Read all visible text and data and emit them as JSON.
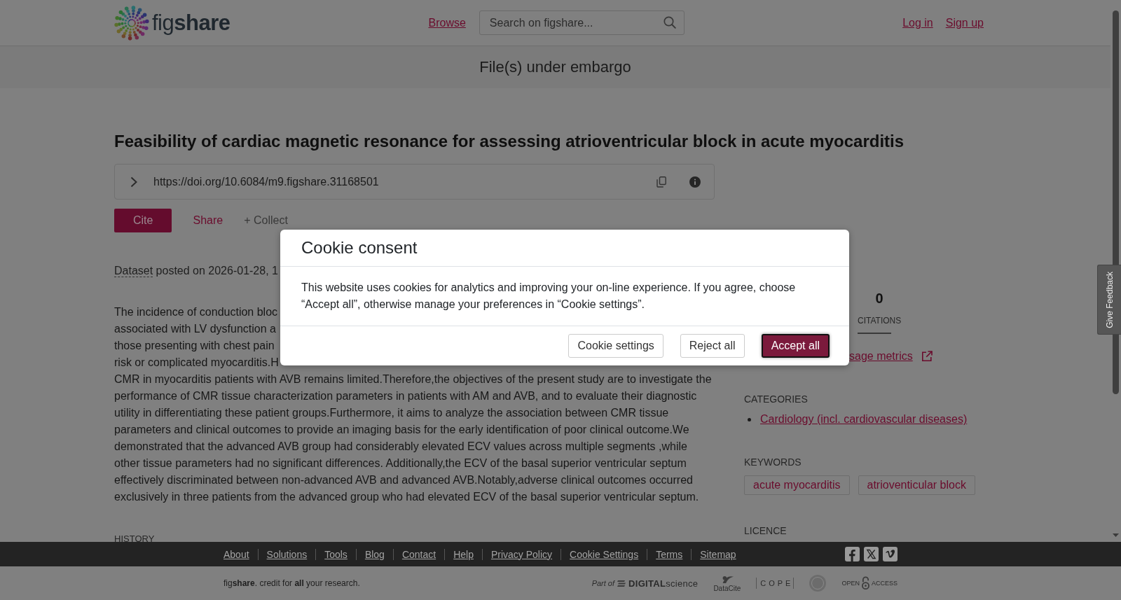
{
  "header": {
    "logo": "fig**share**",
    "nav": [
      "Browse"
    ],
    "search": {
      "placeholder": "Search on figshare..."
    },
    "account_links": [
      "Log in",
      "Sign up"
    ]
  },
  "notice": {
    "text": "File(s) under embargo"
  },
  "item": {
    "title": "Feasibility of cardiac magnetic resonance for assessing atrioventricular block in acute myocarditis",
    "doi": "https://doi.org/10.6084/m9.figshare.31168501",
    "actions": [
      {
        "label": "Cite",
        "kind": "primary"
      },
      {
        "label": "Share",
        "kind": "link"
      },
      {
        "label": "+ Collect",
        "kind": "plain"
      }
    ],
    "item_type": "Dataset",
    "posted": "posted on 2026-01-28, 1",
    "description_lines": [
      "The incidence of conduction bloc",
      "associated with LV dysfunction a",
      "those presenting with chest pain",
      "risk or complicated myocarditis.H",
      "CMR in myocarditis patients with AVB remains limited.Therefore,the objectives of the present study are to investigate the",
      "performance of CMR tissue characterization parameters in patients with AM and AVB, and to evaluate their diagnostic",
      "utility in differentiating these patient groups.Furthermore, it aims to analyze the association between CMR tissue",
      "parameters and clinical outcomes to provide an imaging basis for the early identification of poor clinical outcome.We",
      "demonstrated that the advanced AVB group had considerably elevated ECV values across multiple segments ,while",
      "other tissue parameters had no significant differences. Additionally,the ECV of the basal superior ventricular septum",
      "effectively discriminated between non-advanced AVB and advanced AVB.Notably,adverse clinical outcomes occurred",
      "exclusively in three patients from the advanced group who had elevated ECV of the basal superior ventricular septum."
    ],
    "history_heading": "HISTORY"
  },
  "sidebar": {
    "stats": [
      {
        "value": "0",
        "label": "CITATIONS"
      }
    ],
    "usage_link": "sage metrics",
    "sections": [
      {
        "kind": "categories",
        "heading": "CATEGORIES",
        "items": [
          "Cardiology (incl. cardiovascular diseases)"
        ]
      },
      {
        "kind": "keywords",
        "heading": "KEYWORDS",
        "items": [
          "acute myocarditis",
          "atrioventicular block"
        ]
      },
      {
        "kind": "licence",
        "heading": "LICENCE"
      }
    ]
  },
  "feedback_tab": {
    "label": "Give Feedback"
  },
  "footer": {
    "links": [
      "About",
      "Solutions",
      "Tools",
      "Blog",
      "Contact",
      "Help",
      "Privacy Policy",
      "Cookie Settings",
      "Terms",
      "Sitemap"
    ],
    "social": [
      {
        "kind": "facebook"
      },
      {
        "kind": "x"
      },
      {
        "kind": "vimeo"
      }
    ],
    "tagline": "fig**share**. credit for **all** your research.",
    "partners": [
      {
        "kind": "digital_science",
        "texts": [
          "Part of",
          "**DIGITAL**science"
        ]
      },
      {
        "kind": "datacite",
        "texts": [
          "DataCite"
        ]
      },
      {
        "kind": "cope",
        "texts": [
          "COPE"
        ]
      },
      {
        "kind": "seal"
      },
      {
        "kind": "open_access",
        "texts": [
          "OPEN",
          "ACCESS"
        ]
      }
    ]
  },
  "cookie_dialog": {
    "title": "Cookie consent",
    "message": "This website uses cookies for analytics and improving your on-line experience. If you agree, choose “Accept all”, otherwise manage your preferences in “Cookie settings”.",
    "buttons": [
      {
        "label": "Cookie settings",
        "kind": "secondary",
        "focused": false
      },
      {
        "label": "Reject all",
        "kind": "secondary",
        "focused": false
      },
      {
        "label": "Accept all",
        "kind": "primary",
        "focused": true
      }
    ]
  }
}
